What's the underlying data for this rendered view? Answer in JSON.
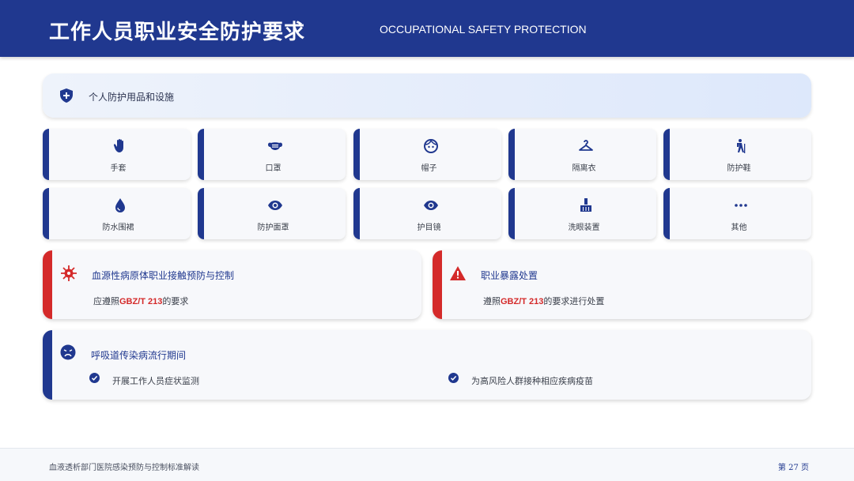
{
  "header": {
    "title": "工作人员职业安全防护要求",
    "subtitle": "OCCUPATIONAL SAFETY PROTECTION"
  },
  "ppe": {
    "label": "个人防护用品和设施",
    "icon": "shield-plus-icon",
    "items": [
      {
        "label": "手套",
        "icon": "hand-icon"
      },
      {
        "label": "口罩",
        "icon": "mask-icon"
      },
      {
        "label": "帽子",
        "icon": "face-icon"
      },
      {
        "label": "隔离衣",
        "icon": "hanger-icon"
      },
      {
        "label": "防护鞋",
        "icon": "hiking-icon"
      },
      {
        "label": "防水围裙",
        "icon": "water-drop-icon"
      },
      {
        "label": "防护面罩",
        "icon": "eye-icon"
      },
      {
        "label": "护目镜",
        "icon": "eye-icon"
      },
      {
        "label": "洗眼装置",
        "icon": "sink-icon"
      },
      {
        "label": "其他",
        "icon": "ellipsis-icon"
      }
    ]
  },
  "blood": {
    "title": "血源性病原体职业接触预防与控制",
    "text_prefix": "应遵照",
    "standard": "GBZ/T 213",
    "text_suffix": "的要求",
    "icon": "virus-icon"
  },
  "exposure": {
    "title": "职业暴露处置",
    "text_prefix": "遵照",
    "standard": "GBZ/T 213",
    "text_suffix": "的要求进行处置",
    "icon": "warning-icon"
  },
  "respiratory": {
    "title": "呼吸道传染病流行期间",
    "icon": "sick-face-icon",
    "items": [
      {
        "label": "开展工作人员症状监测"
      },
      {
        "label": "为高风险人群接种相应疾病疫苗"
      }
    ]
  },
  "footer": {
    "text": "血液透析部门医院感染预防与控制标准解读",
    "page": "第 27 页"
  },
  "colors": {
    "primary": "#20388f",
    "accent_red": "#d42a2a"
  }
}
